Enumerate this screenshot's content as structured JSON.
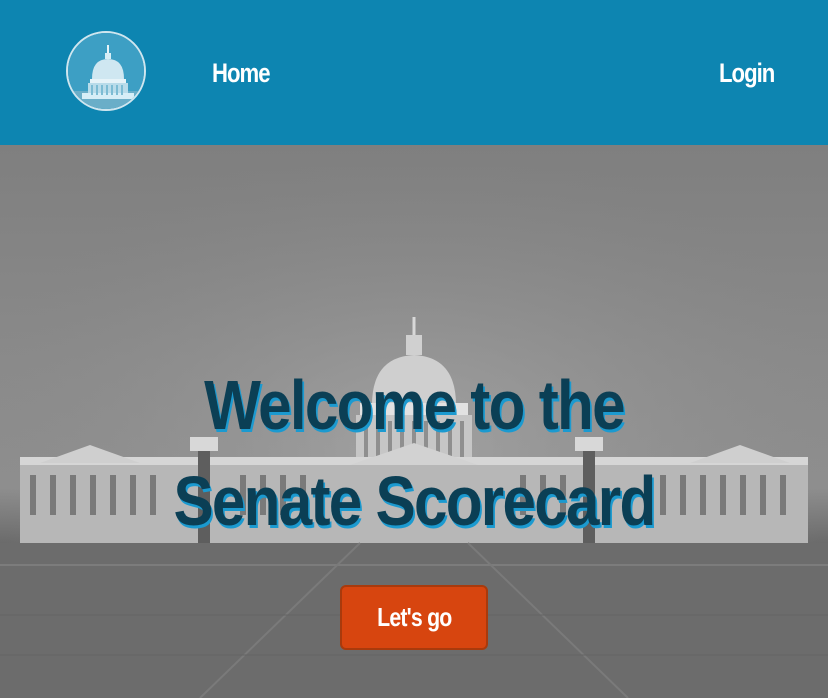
{
  "nav": {
    "logo_icon": "capitol-dome-icon",
    "home_label": "Home",
    "login_label": "Login",
    "bar_color": "#0d85b1"
  },
  "hero": {
    "background": "capitol-building-night-photo",
    "title": "Welcome to the Senate Scorecard",
    "title_color": "#0b3f55",
    "cta_label": "Let's go",
    "cta_color": "#d7450f"
  }
}
